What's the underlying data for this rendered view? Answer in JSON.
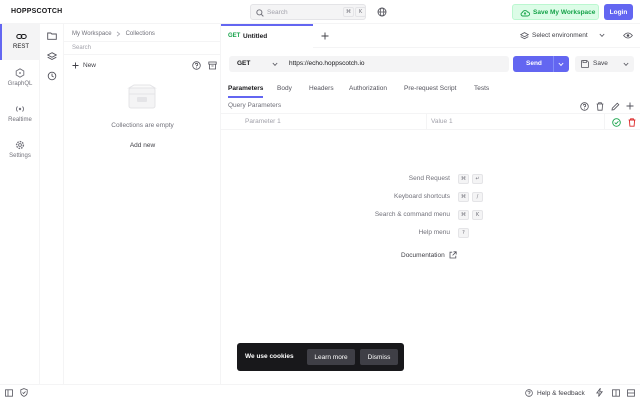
{
  "header": {
    "logo": "HOPPSCOTCH",
    "search_placeholder": "Search",
    "search_keys": [
      "⌘",
      "K"
    ],
    "save_workspace_label": "Save My Workspace",
    "login_label": "Login"
  },
  "rail": {
    "items": [
      {
        "label": "REST"
      },
      {
        "label": "GraphQL"
      },
      {
        "label": "Realtime"
      },
      {
        "label": "Settings"
      }
    ]
  },
  "collections": {
    "breadcrumb": [
      "My Workspace",
      "Collections"
    ],
    "search_placeholder": "Search",
    "new_label": "New",
    "empty_text": "Collections are empty",
    "add_new_label": "Add new"
  },
  "request": {
    "tab_method": "GET",
    "tab_title": "Untitled",
    "environment_label": "Select environment",
    "method": "GET",
    "url": "https://echo.hoppscotch.io",
    "send_label": "Send",
    "save_label": "Save",
    "subtabs": [
      "Parameters",
      "Body",
      "Headers",
      "Authorization",
      "Pre-request Script",
      "Tests"
    ],
    "active_subtab": "Parameters",
    "query_params_label": "Query Parameters",
    "param_key_placeholder": "Parameter 1",
    "param_value_placeholder": "Value 1"
  },
  "shortcuts": [
    {
      "label": "Send Request",
      "keys": [
        "⌘",
        "↵"
      ]
    },
    {
      "label": "Keyboard shortcuts",
      "keys": [
        "⌘",
        "/"
      ]
    },
    {
      "label": "Search & command menu",
      "keys": [
        "⌘",
        "K"
      ]
    },
    {
      "label": "Help menu",
      "keys": [
        "?"
      ]
    }
  ],
  "documentation_label": "Documentation",
  "cookie": {
    "text": "We use cookies",
    "learn_more_label": "Learn more",
    "dismiss_label": "Dismiss"
  },
  "footer": {
    "help_label": "Help & feedback"
  },
  "colors": {
    "accent": "#6366f1",
    "save_workspace_bg": "#dcfce7",
    "save_workspace_text": "#16a34a",
    "method_green": "#16a34a",
    "delete_red": "#dc2626",
    "cookie_bg": "#18181b"
  }
}
